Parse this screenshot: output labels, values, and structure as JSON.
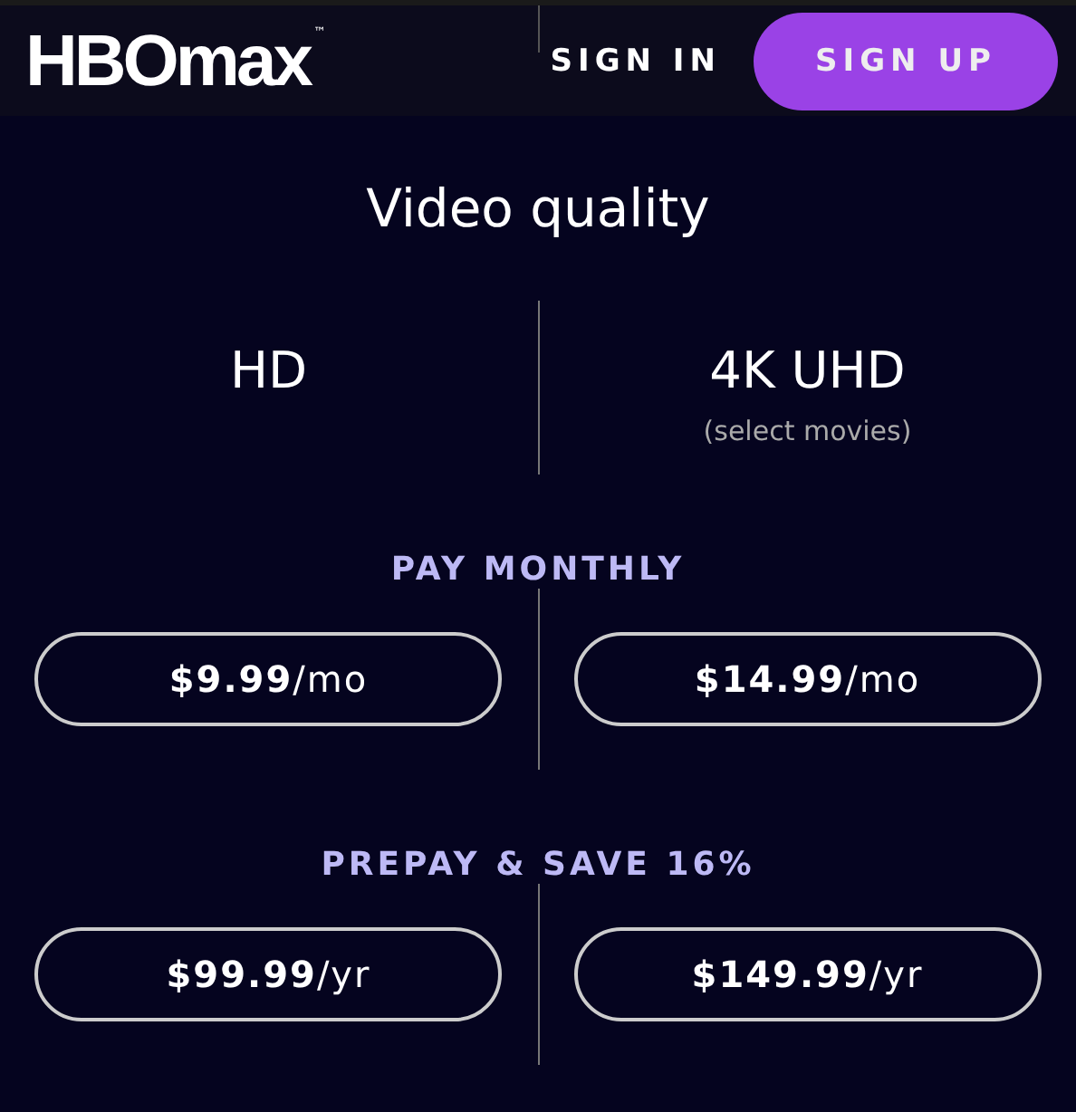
{
  "header": {
    "logo": "HBOmax",
    "trademark": "™",
    "sign_in": "SIGN IN",
    "sign_up": "SIGN UP"
  },
  "title": "Video quality",
  "qualities": [
    {
      "name": "HD"
    },
    {
      "name": "4K UHD",
      "note": "(select movies)"
    }
  ],
  "sections": [
    {
      "heading": "PAY MONTHLY",
      "plans": [
        {
          "price": "$9.99",
          "period": "/mo"
        },
        {
          "price": "$14.99",
          "period": "/mo"
        }
      ]
    },
    {
      "heading": "PREPAY & SAVE 16%",
      "plans": [
        {
          "price": "$99.99",
          "period": "/yr"
        },
        {
          "price": "$149.99",
          "period": "/yr"
        }
      ]
    }
  ]
}
